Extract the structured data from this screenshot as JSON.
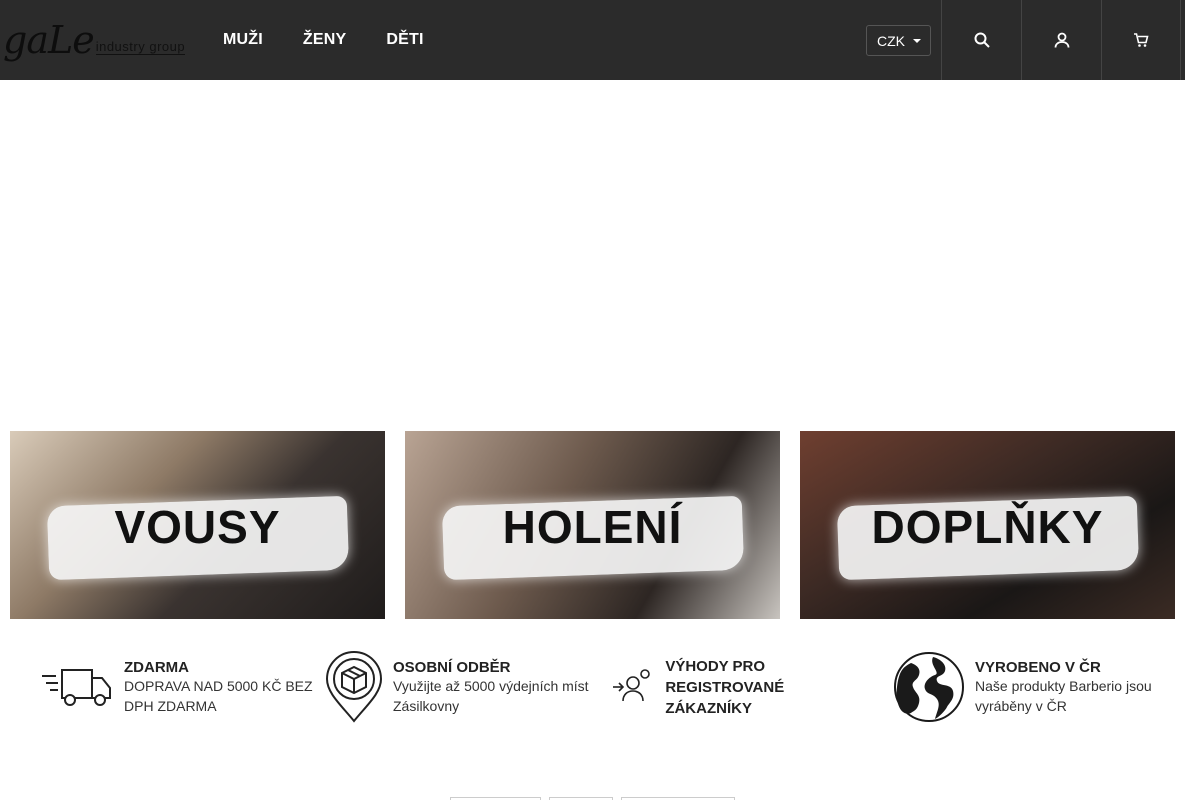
{
  "header": {
    "logo_text": "gaLe",
    "logo_sub": "industry group",
    "nav": [
      "MUŽI",
      "ŽENY",
      "DĚTI"
    ],
    "currency": "CZK"
  },
  "banners": [
    {
      "label": "VOUSY"
    },
    {
      "label": "HOLENÍ"
    },
    {
      "label": "DOPLŇKY"
    }
  ],
  "features": [
    {
      "title": "ZDARMA",
      "desc": "DOPRAVA NAD 5000 KČ BEZ DPH ZDARMA",
      "icon": "delivery-truck-icon"
    },
    {
      "title": "OSOBNÍ ODBĚR",
      "desc": "Využijte až 5000 výdejních míst Zásilkovny",
      "icon": "map-pin-package-icon"
    },
    {
      "title": "VÝHODY PRO REGISTROVANÉ ZÁKAZNÍKY",
      "desc": "",
      "icon": "user-login-icon"
    },
    {
      "title": "VYROBENO V ČR",
      "desc": "Naše produkty Barberio jsou vyráběny v ČR",
      "icon": "globe-icon"
    }
  ],
  "colors": {
    "header_bg": "#2b2b2b",
    "header_text": "#ffffff"
  }
}
